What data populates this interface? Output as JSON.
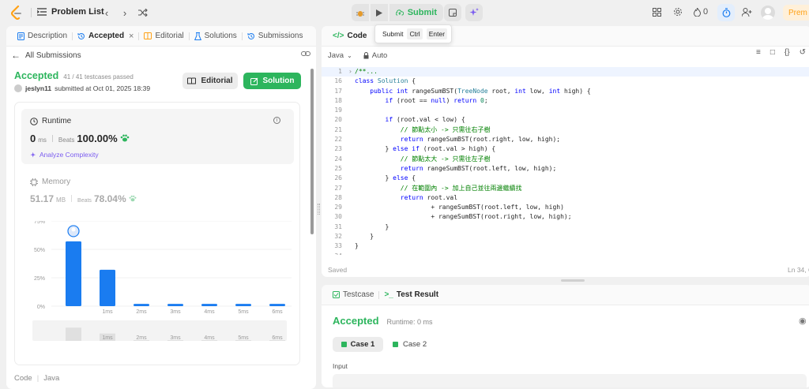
{
  "topbar": {
    "problem_list": "Problem List",
    "submit": "Submit",
    "streak": "0",
    "premium": "Prem"
  },
  "tooltip": {
    "label": "Submit",
    "key1": "Ctrl",
    "key2": "Enter"
  },
  "left": {
    "tabs": [
      "Description",
      "Accepted",
      "Editorial",
      "Solutions",
      "Submissions"
    ],
    "back": "All Submissions",
    "status": "Accepted",
    "passed": "41 / 41 testcases passed",
    "user": "jeslyn11",
    "submitted": "submitted at Oct 01, 2025 18:39",
    "editorial_btn": "Editorial",
    "solution_btn": "Solution",
    "runtime": {
      "title": "Runtime",
      "value": "0",
      "unit": "ms",
      "beats_label": "Beats",
      "beats": "100.00%",
      "analyze": "Analyze Complexity"
    },
    "memory": {
      "title": "Memory",
      "value": "51.17",
      "unit": "MB",
      "beats_label": "Beats",
      "beats": "78.04%"
    },
    "footer": [
      "Code",
      "Java"
    ]
  },
  "chart_data": {
    "type": "bar",
    "categories": [
      "",
      "1ms",
      "2ms",
      "3ms",
      "4ms",
      "5ms",
      "6ms"
    ],
    "values": [
      57,
      32,
      2,
      2,
      2,
      2,
      2
    ],
    "yticks": [
      "75%",
      "50%",
      "25%",
      "0%"
    ],
    "ylim": [
      0,
      75
    ],
    "mini_labels": [
      "",
      "1ms",
      "2ms",
      "3ms",
      "4ms",
      "5ms",
      "6ms"
    ]
  },
  "code": {
    "tab": "Code",
    "lang": "Java",
    "auto": "Auto",
    "saved": "Saved",
    "pos": "Ln 34, C",
    "lines": [
      {
        "n": "1",
        "t": "/**..."
      },
      {
        "n": "16",
        "t": "class Solution {"
      },
      {
        "n": "17",
        "t": "    public int rangeSumBST(TreeNode root, int low, int high) {"
      },
      {
        "n": "18",
        "t": "        if (root == null) return 0;"
      },
      {
        "n": "19",
        "t": ""
      },
      {
        "n": "20",
        "t": "        if (root.val < low) {"
      },
      {
        "n": "21",
        "t": "            // 節點太小 -> 只需往右子樹"
      },
      {
        "n": "22",
        "t": "            return rangeSumBST(root.right, low, high);"
      },
      {
        "n": "23",
        "t": "        } else if (root.val > high) {"
      },
      {
        "n": "24",
        "t": "            // 節點太大 -> 只需往左子樹"
      },
      {
        "n": "25",
        "t": "            return rangeSumBST(root.left, low, high);"
      },
      {
        "n": "26",
        "t": "        } else {"
      },
      {
        "n": "27",
        "t": "            // 在範圍內 -> 加上自己並往兩邊繼續找"
      },
      {
        "n": "28",
        "t": "            return root.val"
      },
      {
        "n": "29",
        "t": "                    + rangeSumBST(root.left, low, high)"
      },
      {
        "n": "30",
        "t": "                    + rangeSumBST(root.right, low, high);"
      },
      {
        "n": "31",
        "t": "        }"
      },
      {
        "n": "32",
        "t": "    }"
      },
      {
        "n": "33",
        "t": "}"
      },
      {
        "n": "34",
        "t": ""
      }
    ]
  },
  "test": {
    "tab1": "Testcase",
    "tab2": "Test Result",
    "status": "Accepted",
    "runtime": "Runtime: 0 ms",
    "case1": "Case 1",
    "case2": "Case 2",
    "input": "Input"
  },
  "colors": {
    "accent_green": "#2db55d",
    "bar_blue": "#1a7cf0",
    "accent_orange": "#ffa116"
  }
}
